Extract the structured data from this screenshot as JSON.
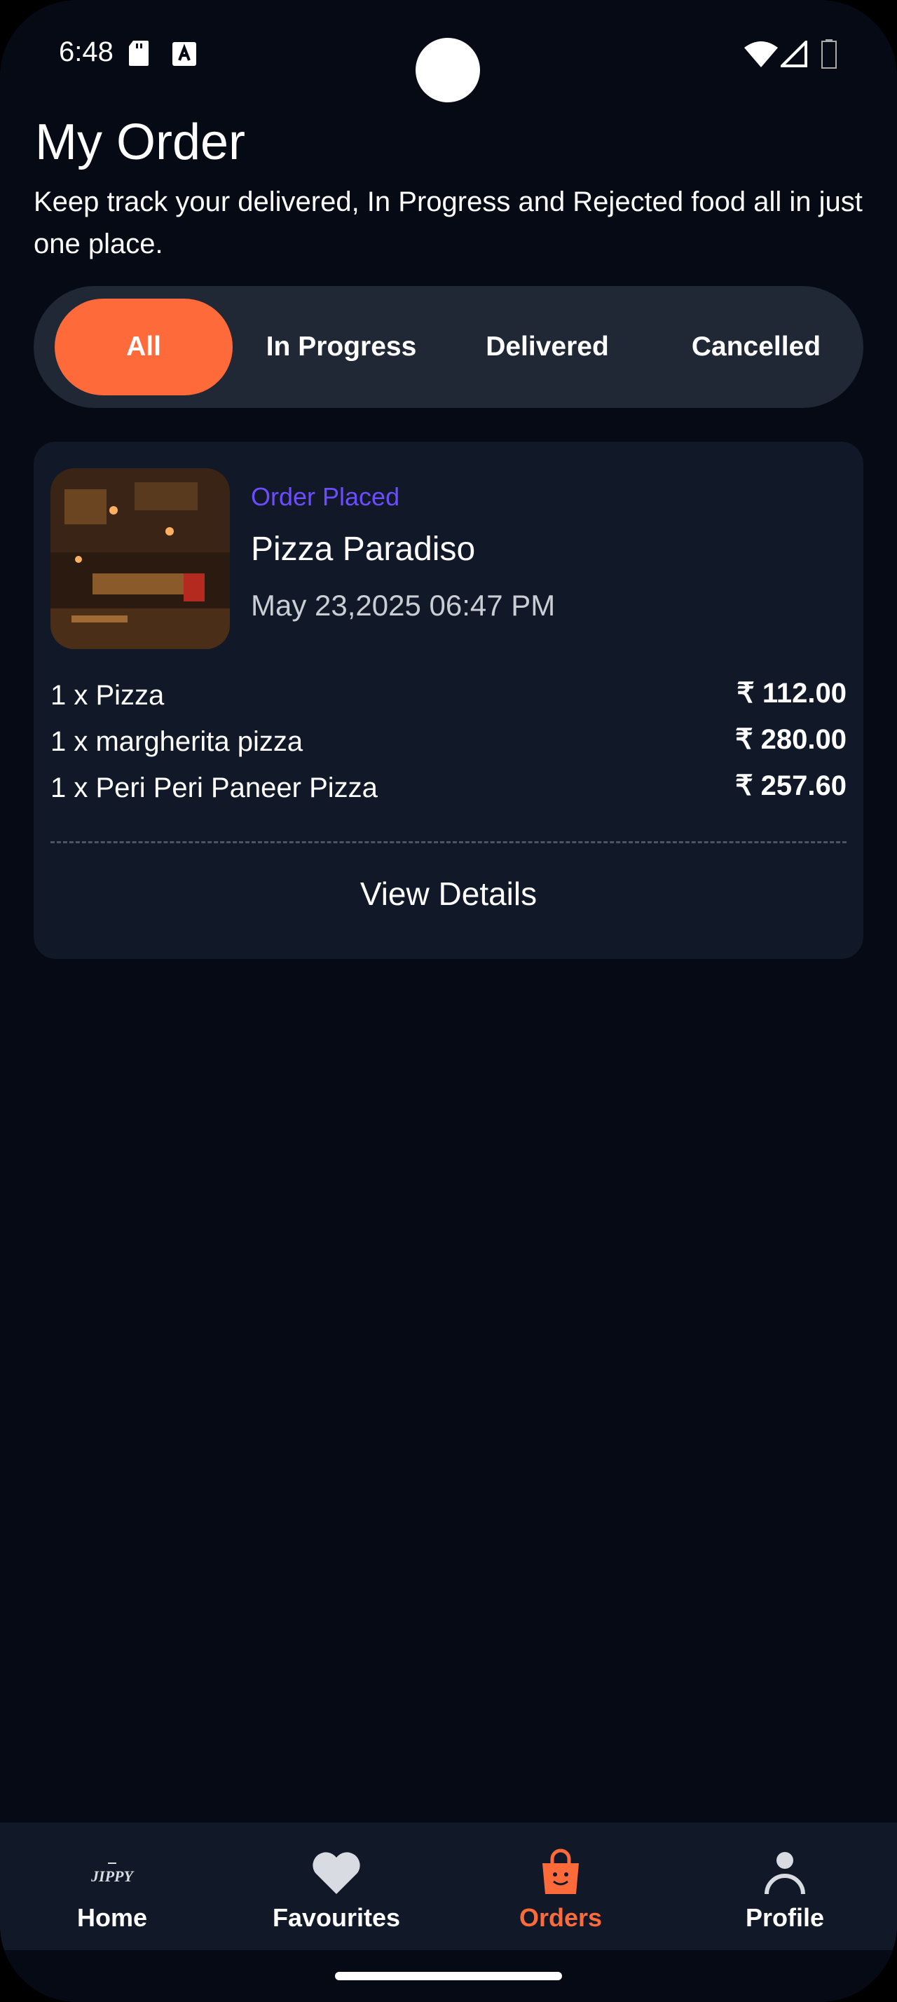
{
  "status_bar": {
    "time": "6:48"
  },
  "header": {
    "title": "My Order",
    "subtitle": "Keep track your delivered, In Progress and Rejected food all in just one place."
  },
  "tabs": [
    {
      "label": "All",
      "selected": true
    },
    {
      "label": "In Progress",
      "selected": false
    },
    {
      "label": "Delivered",
      "selected": false
    },
    {
      "label": "Cancelled",
      "selected": false
    }
  ],
  "order": {
    "status": "Order Placed",
    "restaurant": "Pizza Paradiso",
    "date": "May 23,2025 06:47 PM",
    "items": [
      {
        "name": "1 x Pizza",
        "price": "₹ 112.00"
      },
      {
        "name": "1 x margherita pizza",
        "price": "₹ 280.00"
      },
      {
        "name": "1 x Peri Peri Paneer Pizza",
        "price": "₹ 257.60"
      }
    ],
    "action": "View Details"
  },
  "bottom_nav": [
    {
      "label": "Home",
      "icon": "jippy-logo-icon",
      "logo_text": "JIPPY",
      "active": false
    },
    {
      "label": "Favourites",
      "icon": "heart-icon",
      "active": false
    },
    {
      "label": "Orders",
      "icon": "shopping-bag-icon",
      "active": true
    },
    {
      "label": "Profile",
      "icon": "person-icon",
      "active": false
    }
  ],
  "colors": {
    "accent": "#ff6a3a",
    "status_purple": "#6b4dff",
    "background": "#060a14",
    "card": "#111827"
  }
}
